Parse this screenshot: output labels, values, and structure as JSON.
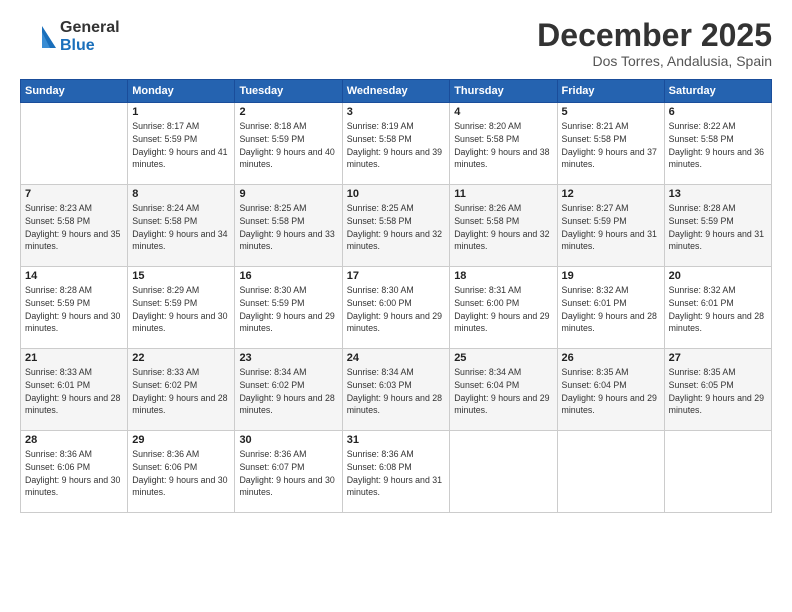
{
  "header": {
    "logo_general": "General",
    "logo_blue": "Blue",
    "month_title": "December 2025",
    "location": "Dos Torres, Andalusia, Spain"
  },
  "days_of_week": [
    "Sunday",
    "Monday",
    "Tuesday",
    "Wednesday",
    "Thursday",
    "Friday",
    "Saturday"
  ],
  "weeks": [
    [
      {
        "day": "",
        "sunrise": "",
        "sunset": "",
        "daylight": ""
      },
      {
        "day": "1",
        "sunrise": "Sunrise: 8:17 AM",
        "sunset": "Sunset: 5:59 PM",
        "daylight": "Daylight: 9 hours and 41 minutes."
      },
      {
        "day": "2",
        "sunrise": "Sunrise: 8:18 AM",
        "sunset": "Sunset: 5:59 PM",
        "daylight": "Daylight: 9 hours and 40 minutes."
      },
      {
        "day": "3",
        "sunrise": "Sunrise: 8:19 AM",
        "sunset": "Sunset: 5:58 PM",
        "daylight": "Daylight: 9 hours and 39 minutes."
      },
      {
        "day": "4",
        "sunrise": "Sunrise: 8:20 AM",
        "sunset": "Sunset: 5:58 PM",
        "daylight": "Daylight: 9 hours and 38 minutes."
      },
      {
        "day": "5",
        "sunrise": "Sunrise: 8:21 AM",
        "sunset": "Sunset: 5:58 PM",
        "daylight": "Daylight: 9 hours and 37 minutes."
      },
      {
        "day": "6",
        "sunrise": "Sunrise: 8:22 AM",
        "sunset": "Sunset: 5:58 PM",
        "daylight": "Daylight: 9 hours and 36 minutes."
      }
    ],
    [
      {
        "day": "7",
        "sunrise": "Sunrise: 8:23 AM",
        "sunset": "Sunset: 5:58 PM",
        "daylight": "Daylight: 9 hours and 35 minutes."
      },
      {
        "day": "8",
        "sunrise": "Sunrise: 8:24 AM",
        "sunset": "Sunset: 5:58 PM",
        "daylight": "Daylight: 9 hours and 34 minutes."
      },
      {
        "day": "9",
        "sunrise": "Sunrise: 8:25 AM",
        "sunset": "Sunset: 5:58 PM",
        "daylight": "Daylight: 9 hours and 33 minutes."
      },
      {
        "day": "10",
        "sunrise": "Sunrise: 8:25 AM",
        "sunset": "Sunset: 5:58 PM",
        "daylight": "Daylight: 9 hours and 32 minutes."
      },
      {
        "day": "11",
        "sunrise": "Sunrise: 8:26 AM",
        "sunset": "Sunset: 5:58 PM",
        "daylight": "Daylight: 9 hours and 32 minutes."
      },
      {
        "day": "12",
        "sunrise": "Sunrise: 8:27 AM",
        "sunset": "Sunset: 5:59 PM",
        "daylight": "Daylight: 9 hours and 31 minutes."
      },
      {
        "day": "13",
        "sunrise": "Sunrise: 8:28 AM",
        "sunset": "Sunset: 5:59 PM",
        "daylight": "Daylight: 9 hours and 31 minutes."
      }
    ],
    [
      {
        "day": "14",
        "sunrise": "Sunrise: 8:28 AM",
        "sunset": "Sunset: 5:59 PM",
        "daylight": "Daylight: 9 hours and 30 minutes."
      },
      {
        "day": "15",
        "sunrise": "Sunrise: 8:29 AM",
        "sunset": "Sunset: 5:59 PM",
        "daylight": "Daylight: 9 hours and 30 minutes."
      },
      {
        "day": "16",
        "sunrise": "Sunrise: 8:30 AM",
        "sunset": "Sunset: 5:59 PM",
        "daylight": "Daylight: 9 hours and 29 minutes."
      },
      {
        "day": "17",
        "sunrise": "Sunrise: 8:30 AM",
        "sunset": "Sunset: 6:00 PM",
        "daylight": "Daylight: 9 hours and 29 minutes."
      },
      {
        "day": "18",
        "sunrise": "Sunrise: 8:31 AM",
        "sunset": "Sunset: 6:00 PM",
        "daylight": "Daylight: 9 hours and 29 minutes."
      },
      {
        "day": "19",
        "sunrise": "Sunrise: 8:32 AM",
        "sunset": "Sunset: 6:01 PM",
        "daylight": "Daylight: 9 hours and 28 minutes."
      },
      {
        "day": "20",
        "sunrise": "Sunrise: 8:32 AM",
        "sunset": "Sunset: 6:01 PM",
        "daylight": "Daylight: 9 hours and 28 minutes."
      }
    ],
    [
      {
        "day": "21",
        "sunrise": "Sunrise: 8:33 AM",
        "sunset": "Sunset: 6:01 PM",
        "daylight": "Daylight: 9 hours and 28 minutes."
      },
      {
        "day": "22",
        "sunrise": "Sunrise: 8:33 AM",
        "sunset": "Sunset: 6:02 PM",
        "daylight": "Daylight: 9 hours and 28 minutes."
      },
      {
        "day": "23",
        "sunrise": "Sunrise: 8:34 AM",
        "sunset": "Sunset: 6:02 PM",
        "daylight": "Daylight: 9 hours and 28 minutes."
      },
      {
        "day": "24",
        "sunrise": "Sunrise: 8:34 AM",
        "sunset": "Sunset: 6:03 PM",
        "daylight": "Daylight: 9 hours and 28 minutes."
      },
      {
        "day": "25",
        "sunrise": "Sunrise: 8:34 AM",
        "sunset": "Sunset: 6:04 PM",
        "daylight": "Daylight: 9 hours and 29 minutes."
      },
      {
        "day": "26",
        "sunrise": "Sunrise: 8:35 AM",
        "sunset": "Sunset: 6:04 PM",
        "daylight": "Daylight: 9 hours and 29 minutes."
      },
      {
        "day": "27",
        "sunrise": "Sunrise: 8:35 AM",
        "sunset": "Sunset: 6:05 PM",
        "daylight": "Daylight: 9 hours and 29 minutes."
      }
    ],
    [
      {
        "day": "28",
        "sunrise": "Sunrise: 8:36 AM",
        "sunset": "Sunset: 6:06 PM",
        "daylight": "Daylight: 9 hours and 30 minutes."
      },
      {
        "day": "29",
        "sunrise": "Sunrise: 8:36 AM",
        "sunset": "Sunset: 6:06 PM",
        "daylight": "Daylight: 9 hours and 30 minutes."
      },
      {
        "day": "30",
        "sunrise": "Sunrise: 8:36 AM",
        "sunset": "Sunset: 6:07 PM",
        "daylight": "Daylight: 9 hours and 30 minutes."
      },
      {
        "day": "31",
        "sunrise": "Sunrise: 8:36 AM",
        "sunset": "Sunset: 6:08 PM",
        "daylight": "Daylight: 9 hours and 31 minutes."
      },
      {
        "day": "",
        "sunrise": "",
        "sunset": "",
        "daylight": ""
      },
      {
        "day": "",
        "sunrise": "",
        "sunset": "",
        "daylight": ""
      },
      {
        "day": "",
        "sunrise": "",
        "sunset": "",
        "daylight": ""
      }
    ]
  ]
}
